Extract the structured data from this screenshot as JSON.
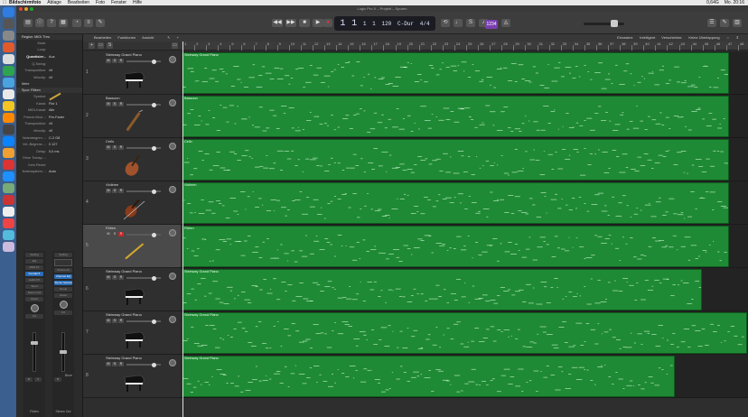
{
  "menubar": {
    "app": "Bildschirmfoto",
    "items": [
      "Ablage",
      "Bearbeiten",
      "Foto",
      "Fenster",
      "Hilfe"
    ],
    "battery": "0,64G",
    "clock": "Mo. 20:16"
  },
  "window": {
    "title": "Logic Pro X – Projekt – Spuren"
  },
  "lcd": {
    "bar": "1",
    "beat": "1",
    "div": "1",
    "tick": "1",
    "tempo": "120",
    "key": "C-Dur",
    "signature": "4/4"
  },
  "control_bar": {
    "count_in": "1234"
  },
  "inspector": {
    "region_header": "Region: MIDI Thru",
    "region_rows": [
      {
        "k": "Mute:",
        "v": ""
      },
      {
        "k": "Loop:",
        "v": ""
      },
      {
        "k": "Quantisier...",
        "v": "Aus"
      },
      {
        "k": "Q-Swing:",
        "v": ""
      },
      {
        "k": "Transposition:",
        "v": "±0"
      },
      {
        "k": "Velocity:",
        "v": "±0"
      }
    ],
    "more_label": "Mehr",
    "track_header": "Spur: Flöten",
    "track_rows": [
      {
        "k": "Symbol:",
        "v": ""
      },
      {
        "k": "Kanal:",
        "v": "Flut 1"
      },
      {
        "k": "MIDI-Kanal:",
        "v": "Alle"
      },
      {
        "k": "Freeze-Mod...:",
        "v": "Pre-Fader"
      },
      {
        "k": "Transposition:",
        "v": "±0"
      },
      {
        "k": "Velocity:",
        "v": "±0"
      },
      {
        "k": "Notenbegren...:",
        "v": "C-2  G8"
      },
      {
        "k": "Vel.-Begrenz...:",
        "v": "0  127"
      },
      {
        "k": "Delay:",
        "v": "0,0 ms"
      },
      {
        "k": "Ohne Transp...:",
        "v": ""
      },
      {
        "k": "Kein Reset:",
        "v": ""
      },
      {
        "k": "Notensystem...:",
        "v": "Auto"
      }
    ],
    "strip_left": {
      "slots": [
        "Setting",
        "EQ",
        "MIDI FX",
        "Kontakt 5",
        "Audio FX",
        "Send",
        "Stereo Out",
        "Read"
      ],
      "value": "0,0",
      "name": "Flöten",
      "ms": [
        "M",
        "S"
      ]
    },
    "strip_right": {
      "slots": [
        "Setting",
        "",
        "Chorus-Gr",
        "Channel EQ",
        "Stereo Spread",
        "Group",
        "Read"
      ],
      "value": "0,0",
      "bounce": "Bnce",
      "name": "Stereo Out",
      "ms": [
        "M"
      ]
    }
  },
  "tracks_menu": [
    "Bearbeiten",
    "Funktionen",
    "Ansicht"
  ],
  "snap": {
    "label": "Einrasten:",
    "value": "Intelligent"
  },
  "drag": {
    "label": "Verschieben:",
    "value": "Keine Überlappung"
  },
  "ruler_marks": [
    "1",
    "2",
    "3",
    "4",
    "5",
    "6",
    "7",
    "8",
    "9",
    "10",
    "11",
    "12",
    "13",
    "14",
    "15",
    "16",
    "17",
    "18",
    "19",
    "20",
    "21",
    "22",
    "23",
    "24",
    "25",
    "26",
    "27",
    "28",
    "29",
    "30",
    "31",
    "32",
    "33",
    "34",
    "35",
    "36",
    "37",
    "38",
    "39",
    "40",
    "41",
    "42",
    "43",
    "44",
    "45",
    "46",
    "47",
    "48"
  ],
  "tracks": [
    {
      "num": "1",
      "name": "Steinway Grand Piano",
      "region": "Steinway Grand Piano",
      "instrument": "piano",
      "selected": false,
      "rec": false
    },
    {
      "num": "2",
      "name": "Bassoon",
      "region": "Bassoon",
      "instrument": "bassoon",
      "selected": false,
      "rec": false
    },
    {
      "num": "3",
      "name": "Cello",
      "region": "Cello",
      "instrument": "cello",
      "selected": false,
      "rec": false
    },
    {
      "num": "4",
      "name": "Violinen",
      "region": "Violinen",
      "instrument": "violin",
      "selected": false,
      "rec": false
    },
    {
      "num": "5",
      "name": "Flöten",
      "region": "Flöten",
      "instrument": "flute",
      "selected": true,
      "rec": true
    },
    {
      "num": "6",
      "name": "Steinway Grand Piano",
      "region": "Steinway Grand Piano",
      "instrument": "piano",
      "selected": false,
      "rec": false
    },
    {
      "num": "7",
      "name": "Steinway Grand Piano",
      "region": "Steinway Grand Piano",
      "instrument": "piano",
      "selected": false,
      "rec": false
    },
    {
      "num": "8",
      "name": "Steinway Grand Piano",
      "region": "Steinway Grand Piano",
      "instrument": "piano",
      "selected": false,
      "rec": false
    }
  ],
  "colors": {
    "region": "#1f8a35",
    "record": "#c62828",
    "selected_track": "#4a4a4a"
  }
}
